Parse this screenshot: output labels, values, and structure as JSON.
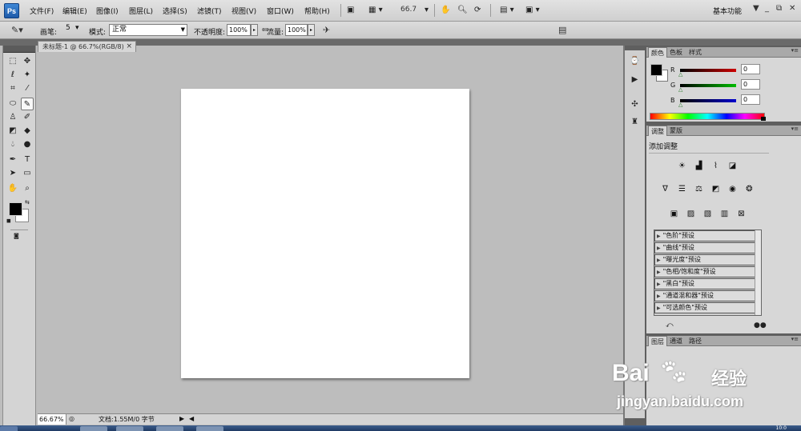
{
  "app": {
    "logo": "Ps"
  },
  "menubar": {
    "items": [
      "文件(F)",
      "编辑(E)",
      "图像(I)",
      "图层(L)",
      "选择(S)",
      "滤镜(T)",
      "视图(V)",
      "窗口(W)",
      "帮助(H)"
    ],
    "zoom": "66.7",
    "workspace": "基本功能",
    "workspace_caret": "▼",
    "min": "_",
    "restore": "⧉",
    "close": "✕"
  },
  "options": {
    "brush_label": "画笔:",
    "brush_size": "5",
    "mode_label": "模式:",
    "mode_value": "正常",
    "opacity_label": "不透明度:",
    "opacity_value": "100%",
    "flow_label": "流量:",
    "flow_value": "100%"
  },
  "document": {
    "tab_title": "未标题-1 @ 66.7%(RGB/8)",
    "tab_close": "×"
  },
  "status": {
    "zoom": "66.67%",
    "doc_info": "文档:1.55M/0 字节",
    "arrow": "▶",
    "scroll_left": "◀"
  },
  "color_panel": {
    "tabs": [
      "颜色",
      "色板",
      "样式"
    ],
    "channels": [
      {
        "label": "R",
        "value": "0",
        "color": "#cc0000"
      },
      {
        "label": "G",
        "value": "0",
        "color": "#00aa00"
      },
      {
        "label": "B",
        "value": "0",
        "color": "#0000cc"
      }
    ],
    "foreground": "#000000",
    "background": "#ffffff"
  },
  "adjustments_panel": {
    "tabs": [
      "调整",
      "蒙版"
    ],
    "title": "添加调整",
    "presets": [
      "\"色阶\"预设",
      "\"曲线\"预设",
      "\"曝光度\"预设",
      "\"色相/饱和度\"预设",
      "\"黑白\"预设",
      "\"通道混和器\"预设",
      "\"可选颜色\"预设"
    ]
  },
  "layers_panel": {
    "tabs": [
      "图层",
      "通道",
      "路径"
    ]
  },
  "watermark": {
    "main": "Bai",
    "cn": "经验",
    "url": "jingyan.baidu.com"
  },
  "taskbar": {
    "clock": "10:0"
  }
}
